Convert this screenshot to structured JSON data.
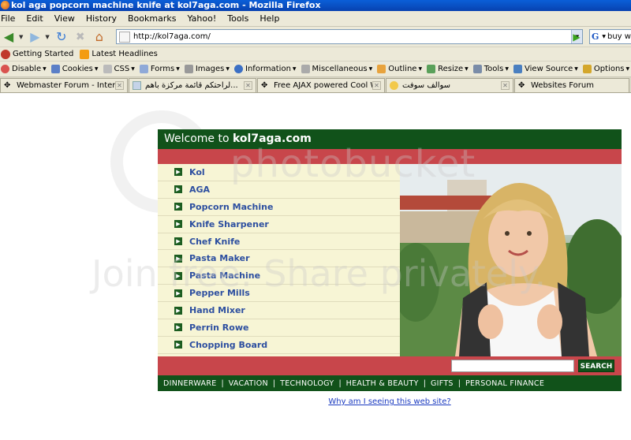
{
  "window": {
    "title": "kol aga popcorn machine knife at kol7aga.com - Mozilla Firefox"
  },
  "menu": [
    "File",
    "Edit",
    "View",
    "History",
    "Bookmarks",
    "Yahoo!",
    "Tools",
    "Help"
  ],
  "nav": {
    "url": "http://kol7aga.com/",
    "search_value": "buy wii"
  },
  "bookmarks": [
    "Getting Started",
    "Latest Headlines"
  ],
  "devtoolbar": [
    "Disable",
    "Cookies",
    "CSS",
    "Forms",
    "Images",
    "Information",
    "Miscellaneous",
    "Outline",
    "Resize",
    "Tools",
    "View Source",
    "Options"
  ],
  "tabs": [
    {
      "label": "Webmaster Forum - Internet ..."
    },
    {
      "label": "لراحتكم قائمة مركزة بأهم..."
    },
    {
      "label": "Free AJAX powered Cool Wall..."
    },
    {
      "label": "سوالف سوفت"
    },
    {
      "label": "Websites Forum"
    }
  ],
  "site": {
    "welcome_prefix": "Welcome to ",
    "welcome_domain": "kol7aga.com",
    "links": [
      "Kol",
      "AGA",
      "Popcorn Machine",
      "Knife Sharpener",
      "Chef Knife",
      "Pasta Maker",
      "Pasta Machine",
      "Pepper Mills",
      "Hand Mixer",
      "Perrin Rowe",
      "Chopping Board"
    ],
    "search_button": "SEARCH",
    "search_value": "",
    "categories": [
      "DINNERWARE",
      "VACATION",
      "TECHNOLOGY",
      "HEALTH & BEAUTY",
      "GIFTS",
      "PERSONAL FINANCE"
    ],
    "why_link": "Why am I seeing this web site?"
  },
  "watermark": {
    "line1": "photobucket",
    "line2": "Join free. Share privately."
  },
  "colors": {
    "site_green": "#11521a",
    "site_red": "#c8464b",
    "link_blue": "#2d4fa0",
    "link_bg": "#f7f5d5"
  }
}
